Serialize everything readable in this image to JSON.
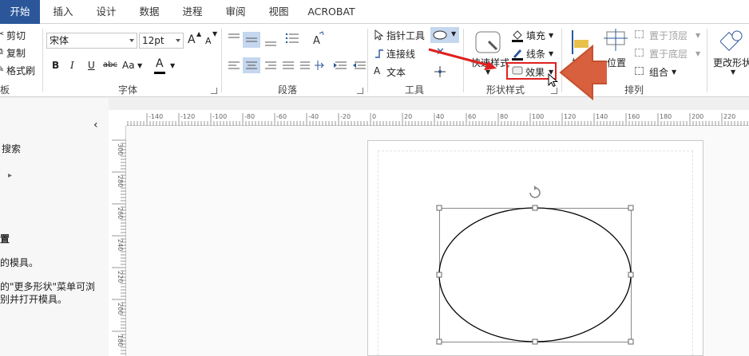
{
  "tabs": [
    "开始",
    "插入",
    "设计",
    "数据",
    "进程",
    "审阅",
    "视图",
    "ACROBAT"
  ],
  "clipboard": {
    "cut": "剪切",
    "copy": "复制",
    "format_painter": "格式刷",
    "group_label": "板"
  },
  "font": {
    "name": "宋体",
    "size": "12pt",
    "grow": "A",
    "shrink": "A",
    "bold": "B",
    "italic": "I",
    "underline": "U",
    "strike": "abc",
    "case": "Aa",
    "color_letter": "A",
    "group_label": "字体"
  },
  "paragraph": {
    "group_label": "段落"
  },
  "tools": {
    "pointer": "指针工具",
    "connector": "连接线",
    "text": "文本",
    "group_label": "工具"
  },
  "shape_styles": {
    "quick_styles": "快速样式",
    "fill": "填充",
    "line": "线条",
    "effects": "效果",
    "group_label": "形状样式"
  },
  "arrange": {
    "position": "位置",
    "bring_front": "置于顶层",
    "send_back": "置于底层",
    "group": "组合",
    "group_label": "排列"
  },
  "edit": {
    "change_shape": "更改形状"
  },
  "shapes_panel": {
    "collapse": "‹",
    "search": "搜索",
    "expand": "▸",
    "heading": "置",
    "line1": "的模具。",
    "line2": "的\"更多形状\"菜单可浏",
    "line3": "别并打开模具。"
  },
  "ruler_top": [
    "-140",
    "-120",
    "-100",
    "-80",
    "-60",
    "-40",
    "-20",
    "0",
    "20",
    "40",
    "60",
    "80",
    "100",
    "120",
    "140",
    "160",
    "180",
    "200",
    "220"
  ],
  "ruler_left": [
    "300",
    "280",
    "260",
    "240",
    "220",
    "200",
    "180"
  ],
  "colors": {
    "tab_active": "#2b579a",
    "callout_red": "#e02020",
    "arrow_orange": "#d9603f",
    "selection": "#c5d7ee"
  }
}
